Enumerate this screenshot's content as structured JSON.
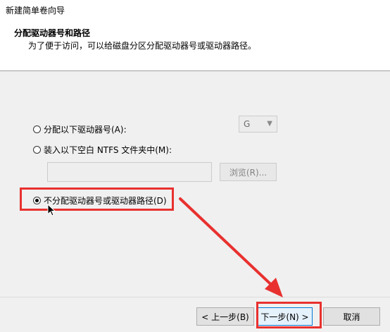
{
  "window": {
    "title": "新建简单卷向导"
  },
  "header": {
    "title": "分配驱动器号和路径",
    "subtitle": "为了便于访问，可以给磁盘分区分配驱动器号或驱动器路径。"
  },
  "options": {
    "assign_letter": {
      "label": "分配以下驱动器号(A):",
      "selected": false
    },
    "drive_letter": {
      "value": "G"
    },
    "mount_folder": {
      "label": "装入以下空白 NTFS 文件夹中(M):",
      "selected": false
    },
    "folder_path": {
      "value": ""
    },
    "browse": {
      "label": "浏览(R)..."
    },
    "no_assign": {
      "label": "不分配驱动器号或驱动器路径(D)",
      "selected": true
    }
  },
  "buttons": {
    "back": "< 上一步(B)",
    "next": "下一步(N) >",
    "cancel": "取消"
  },
  "colors": {
    "annotation": "#e8312f",
    "primary_border": "#0078d7"
  }
}
